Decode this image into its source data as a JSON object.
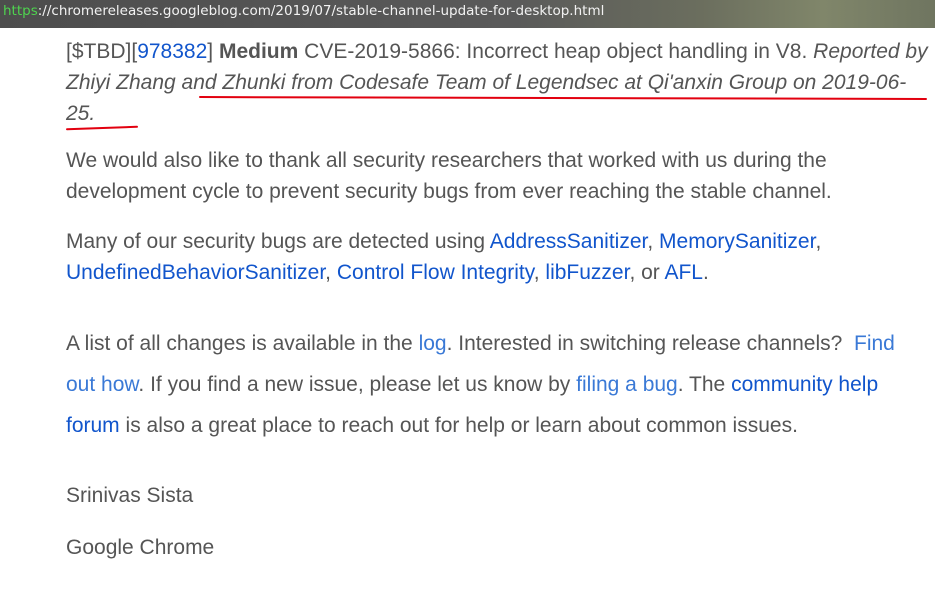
{
  "browser": {
    "url_scheme": "https",
    "url_rest": "://chromereleases.googleblog.com/2019/07/stable-channel-update-for-desktop.html"
  },
  "bug": {
    "tbd": "[$TBD]",
    "bracket_open": "[",
    "id": "978382",
    "bracket_close": "]",
    "severity": "Medium",
    "description": "CVE-2019-5866: Incorrect heap object handling in V8.",
    "reported_prefix": "Reported by",
    "reporter": "Zhiyi Zhang and Zhunki from Codesafe Team of Legendsec at Qi'anxin Group",
    "reported_suffix": "on 2019-06-25."
  },
  "thanks_text": "We would also like to thank all security researchers that worked with us during the development cycle to prevent security bugs from ever reaching the stable channel.",
  "tools": {
    "intro": "Many of our security bugs are detected using",
    "links": [
      "AddressSanitizer",
      "MemorySanitizer",
      "UndefinedBehaviorSanitizer",
      "Control Flow Integrity",
      "libFuzzer",
      "AFL"
    ],
    "sep": ",",
    "or": ", or",
    "end": "."
  },
  "changes": {
    "part1": "A list of all changes is available in the",
    "log_link": "log",
    "part2": ". Interested in switching release channels?",
    "find_out_link": "Find out how",
    "part3": ". If you find a new issue, please let us know by",
    "filing_link": "filing a bug",
    "part4": ". The",
    "forum_link": "community help forum",
    "part5": "is also a great place to reach out for help or learn about common issues."
  },
  "signature": {
    "name": "Srinivas Sista",
    "org": "Google Chrome"
  },
  "colors": {
    "text": "#555555",
    "link": "#1155cc",
    "annotation": "#e2000f"
  }
}
